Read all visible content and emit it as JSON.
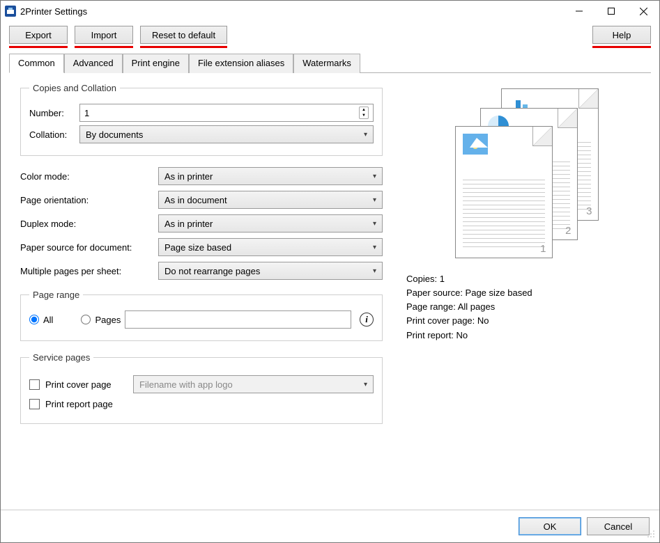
{
  "window": {
    "title": "2Printer Settings"
  },
  "toolbar": {
    "export": "Export",
    "import": "Import",
    "reset": "Reset to default",
    "help": "Help"
  },
  "tabs": {
    "common": "Common",
    "advanced": "Advanced",
    "print_engine": "Print engine",
    "aliases": "File extension aliases",
    "watermarks": "Watermarks"
  },
  "copies": {
    "legend": "Copies and Collation",
    "number_label": "Number:",
    "number_value": "1",
    "collation_label": "Collation:",
    "collation_value": "By documents"
  },
  "settings": {
    "color_mode": {
      "label": "Color mode:",
      "value": "As in printer"
    },
    "orientation": {
      "label": "Page orientation:",
      "value": "As in document"
    },
    "duplex": {
      "label": "Duplex mode:",
      "value": "As in printer"
    },
    "paper_source": {
      "label": "Paper source for document:",
      "value": "Page size based"
    },
    "multi": {
      "label": "Multiple pages per sheet:",
      "value": "Do not rearrange pages"
    }
  },
  "page_range": {
    "legend": "Page range",
    "all": "All",
    "pages": "Pages",
    "pages_value": ""
  },
  "service": {
    "legend": "Service pages",
    "cover": "Print cover page",
    "cover_style": "Filename with app logo",
    "report": "Print report page"
  },
  "summary": {
    "copies": "Copies: 1",
    "paper_source": "Paper source: Page size based",
    "page_range": "Page range: All pages",
    "cover": "Print cover page: No",
    "report": "Print report: No"
  },
  "footer": {
    "ok": "OK",
    "cancel": "Cancel"
  },
  "preview": {
    "n1": "1",
    "n2": "2",
    "n3": "3"
  }
}
